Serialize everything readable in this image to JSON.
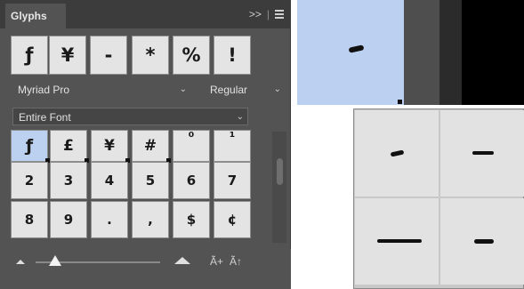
{
  "panel": {
    "tab_label": "Glyphs",
    "expand_icon": ">>",
    "separator": "|",
    "menu_icon": "hamburger-menu-icon"
  },
  "recent_glyphs": [
    "ƒ",
    "¥",
    "-",
    "*",
    "%",
    "!"
  ],
  "font_family": {
    "value": "Myriad Pro",
    "chevron": "⌄"
  },
  "font_style": {
    "value": "Regular",
    "chevron": "⌄"
  },
  "show_filter": {
    "value": "Entire Font",
    "chevron": "⌄"
  },
  "glyph_rows": [
    [
      "ƒ",
      "£",
      "¥",
      "#",
      "⁰",
      "¹"
    ],
    [
      "2",
      "3",
      "4",
      "5",
      "6",
      "7"
    ],
    [
      "8",
      "9",
      ".",
      ",",
      "$",
      "¢"
    ]
  ],
  "bottom_bar": {
    "small_icon": "small-mountain-icon",
    "large_icon": "large-mountain-icon",
    "font_icon_1": "Ã+",
    "font_icon_2": "Ã↑"
  },
  "colors": {
    "panel_bg": "#535353",
    "cell_bg": "#e4e4e4",
    "selected_cell_bg": "#bcd0ef",
    "canvas_selection": "#bcd0f2"
  }
}
